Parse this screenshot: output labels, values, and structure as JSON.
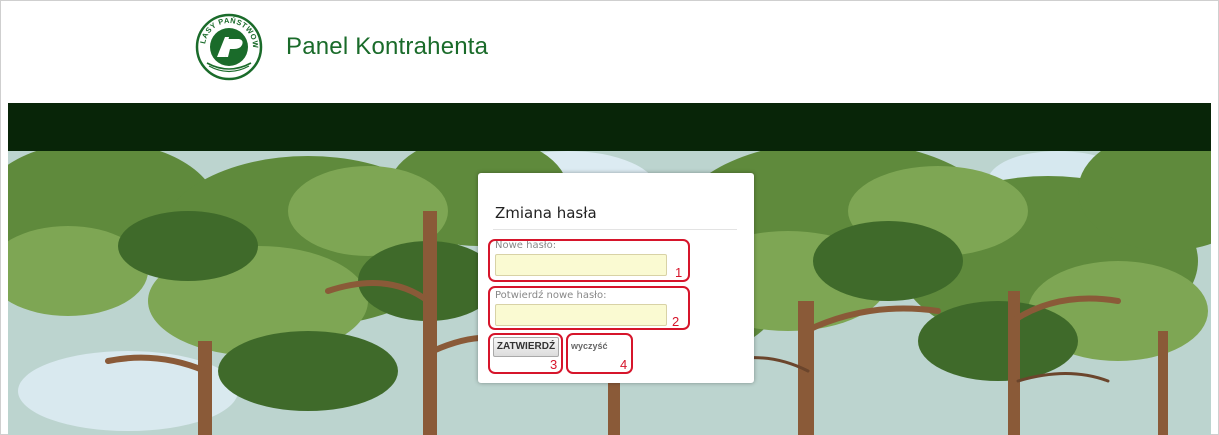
{
  "header": {
    "title": "Panel Kontrahenta",
    "logo_text": "LASY PAŃSTWOWE",
    "logo_icon": "lasy-panstwowe-logo-icon"
  },
  "colors": {
    "brand_green": "#1a6b2a",
    "navbar": "#082508",
    "input_bg": "#fafad2",
    "annotation_red": "#d6152b"
  },
  "form": {
    "title": "Zmiana hasła",
    "new_password_label": "Nowe hasło:",
    "confirm_password_label": "Potwierdź nowe hasło:",
    "new_password_value": "",
    "confirm_password_value": "",
    "submit_label": "ZATWIERDŹ",
    "clear_label": "wyczyść"
  },
  "annotations": {
    "m1": "1",
    "m2": "2",
    "m3": "3",
    "m4": "4"
  }
}
